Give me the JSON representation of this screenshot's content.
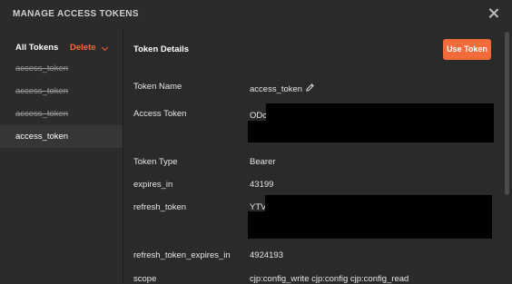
{
  "dialog": {
    "title": "MANAGE ACCESS TOKENS"
  },
  "sidebar": {
    "all_tokens_label": "All Tokens",
    "delete_label": "Delete",
    "items": [
      {
        "label": "access_token",
        "expired": true
      },
      {
        "label": "access_token",
        "expired": true
      },
      {
        "label": "access_token",
        "expired": true
      },
      {
        "label": "access_token",
        "expired": false,
        "selected": true
      }
    ]
  },
  "details": {
    "heading": "Token Details",
    "use_token_label": "Use Token",
    "rows": {
      "token_name": {
        "label": "Token Name",
        "value": "access_token"
      },
      "access_token": {
        "label": "Access Token",
        "value": "ODc"
      },
      "token_type": {
        "label": "Token Type",
        "value": "Bearer"
      },
      "expires_in": {
        "label": "expires_in",
        "value": "43199"
      },
      "refresh_token": {
        "label": "refresh_token",
        "value": "YTV"
      },
      "refresh_token_expires_in": {
        "label": "refresh_token_expires_in",
        "value": "4924193"
      },
      "scope": {
        "label": "scope",
        "value": "cjp:config_write cjp:config cjp:config_read"
      }
    }
  },
  "colors": {
    "accent": "#f26b3a",
    "background": "#2a2a2a",
    "selected_item": "#363636",
    "redaction": "#000000"
  },
  "icons": {
    "close": "close-icon",
    "edit": "pencil-icon",
    "dropdown": "chevron-down-icon"
  }
}
